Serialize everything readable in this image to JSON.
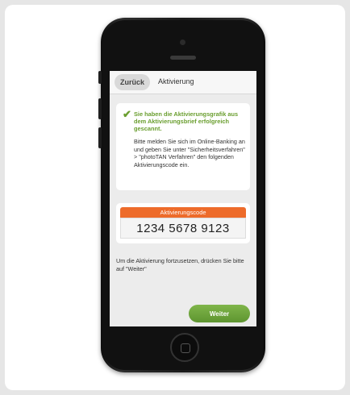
{
  "navbar": {
    "back_label": "Zurück",
    "title": "Aktivierung"
  },
  "message": {
    "success": "Sie haben die Aktivierungsgrafik aus dem Aktivierungsbrief erfolgreich gescannt.",
    "info": "Bitte melden Sie sich im Online-Banking an und geben Sie unter \"Sicherheitsverfahren\" > \"photoTAN Verfahren\" den folgenden Aktivierungscode ein."
  },
  "activation": {
    "header": "Aktivierungscode",
    "code": "1234  5678  9123"
  },
  "instruction": "Um die Aktivierung fortzusetzen, drücken Sie bitte auf \"Weiter\"",
  "next_button": "Weiter",
  "colors": {
    "accent_green": "#6a9e2f",
    "code_orange": "#ed6b2a",
    "button_green": "#6fa53d"
  },
  "icons": {
    "success": "check-icon",
    "home": "home-button-icon"
  }
}
